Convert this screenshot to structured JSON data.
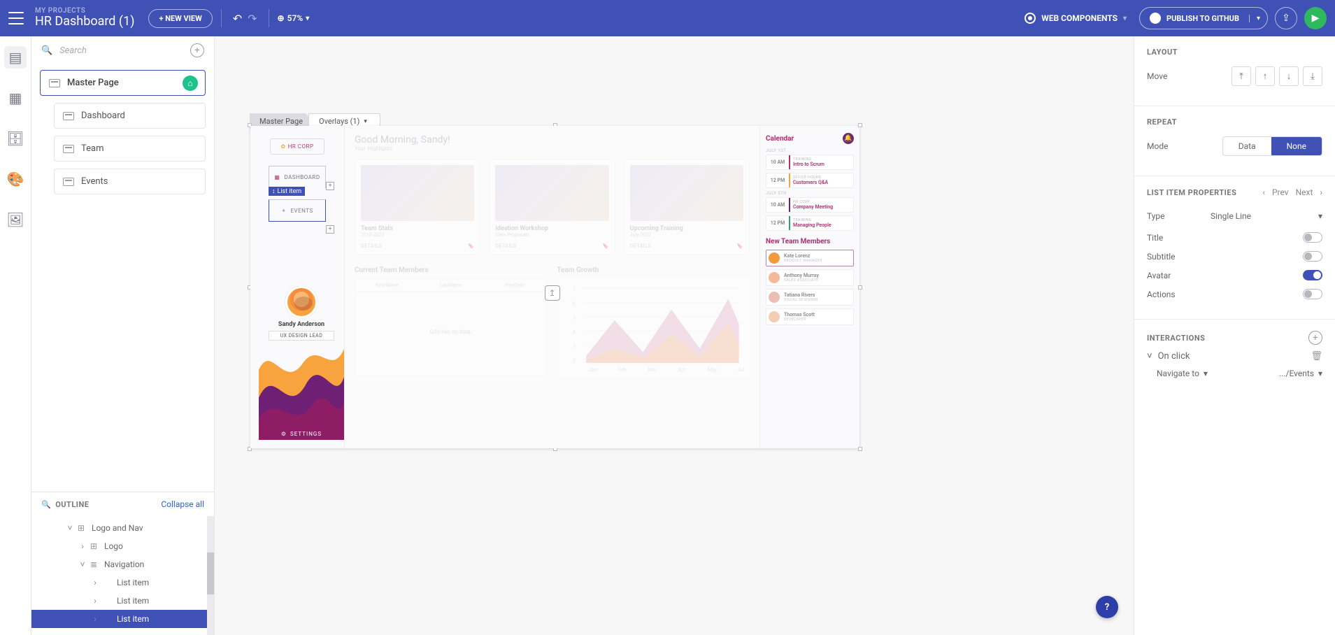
{
  "header": {
    "projects_label": "MY PROJECTS",
    "project_name": "HR Dashboard (1)",
    "new_view": "+ NEW VIEW",
    "zoom": "57%",
    "framework": "WEB COMPONENTS",
    "publish": "PUBLISH TO GITHUB"
  },
  "search": {
    "placeholder": "Search"
  },
  "views": {
    "master": "Master Page",
    "children": [
      "Dashboard",
      "Team",
      "Events"
    ]
  },
  "outline": {
    "title": "OUTLINE",
    "collapse": "Collapse all",
    "items": [
      {
        "label": "Logo and Nav",
        "depth": 0,
        "caret": "˅",
        "icon": "⊞"
      },
      {
        "label": "Logo",
        "depth": 1,
        "caret": "›",
        "icon": "⊞"
      },
      {
        "label": "Navigation",
        "depth": 1,
        "caret": "˅",
        "icon": "≣"
      },
      {
        "label": "List item",
        "depth": 2,
        "caret": "›",
        "icon": ""
      },
      {
        "label": "List item",
        "depth": 2,
        "caret": "›",
        "icon": ""
      },
      {
        "label": "List item",
        "depth": 2,
        "caret": "›",
        "icon": "",
        "selected": true
      }
    ]
  },
  "canvas": {
    "tabs": {
      "master": "Master Page",
      "overlays": "Overlays (1)"
    },
    "selection_label": "List item",
    "sidebar": {
      "logo": "HR CORP",
      "dashboard": "DASHBOARD",
      "events": "EVENTS",
      "profile_name": "Sandy Anderson",
      "profile_role": "UX DESIGN LEAD",
      "settings": "SETTINGS"
    },
    "main": {
      "greeting": "Good Morning, Sandy!",
      "subtitle": "Your Highlights",
      "cards": [
        {
          "title": "Team Stats",
          "sub": "2010-2022",
          "foot": "DETAILS"
        },
        {
          "title": "Ideation Workshop",
          "sub": "View Proposals",
          "foot": "DETAILS"
        },
        {
          "title": "Upcoming Training",
          "sub": "July 2022",
          "foot": "DETAILS"
        }
      ],
      "members_title": "Current Team Members",
      "growth_title": "Team Growth",
      "grid_cols": [
        "FirstName",
        "LastName",
        "HireDate"
      ],
      "grid_empty": "Grid has no data.",
      "chart_months": [
        "Jan",
        "Feb",
        "Mar",
        "Apr",
        "May",
        "Jul"
      ]
    },
    "right": {
      "calendar": "Calendar",
      "dates": [
        "JULY 1ST",
        "JULY 5TH"
      ],
      "items": [
        {
          "time": "10 AM",
          "cat": "TRAINING",
          "title": "Intro to Scrum",
          "color": "#b22d6f"
        },
        {
          "time": "12 PM",
          "cat": "OFFICE HOURS",
          "title": "Customers Q&A",
          "color": "#f9a33f"
        },
        {
          "time": "10 AM",
          "cat": "HR CORP",
          "title": "Company Meeting",
          "color": "#6e2174"
        },
        {
          "time": "12 PM",
          "cat": "TRAINING",
          "title": "Managing People",
          "color": "#2fa36a"
        }
      ],
      "ntm_title": "New Team Members",
      "members": [
        {
          "name": "Kate Lorenz",
          "role": "PRODUCT MANAGER",
          "av": "#f39a3e"
        },
        {
          "name": "Anthony Murray",
          "role": "SALES ASSOCIATE",
          "av": "#f4b89a"
        },
        {
          "name": "Tatiana Rivers",
          "role": "VISUAL DESIGNER",
          "av": "#e9bfb3"
        },
        {
          "name": "Thomas Scott",
          "role": "DEVELOPER",
          "av": "#f3cdb4"
        }
      ]
    }
  },
  "props": {
    "layout_title": "LAYOUT",
    "move": "Move",
    "repeat_title": "REPEAT",
    "mode": "Mode",
    "mode_opts": [
      "Data",
      "None"
    ],
    "list_title": "LIST ITEM PROPERTIES",
    "prev": "Prev",
    "next": "Next",
    "type": "Type",
    "type_value": "Single Line",
    "title": "Title",
    "subtitle": "Subtitle",
    "avatar": "Avatar",
    "actions": "Actions",
    "interactions_title": "INTERACTIONS",
    "on_click": "On click",
    "nav_to": "Navigate to",
    "nav_target": ".../Events"
  }
}
